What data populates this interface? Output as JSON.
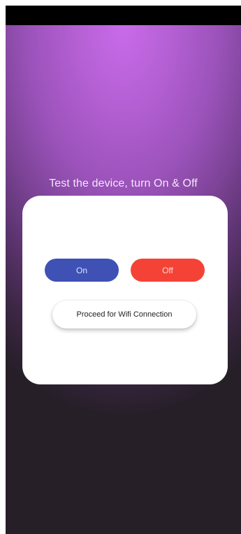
{
  "screen": {
    "heading": "Test the device, turn On & Off"
  },
  "dialog": {
    "on_label": "On",
    "off_label": "Off",
    "proceed_label": "Proceed for Wifi Connection"
  },
  "colors": {
    "on_button": "#3f51b5",
    "off_button": "#f44336",
    "background_top": "#c96bea",
    "background_bottom": "#221c23"
  }
}
